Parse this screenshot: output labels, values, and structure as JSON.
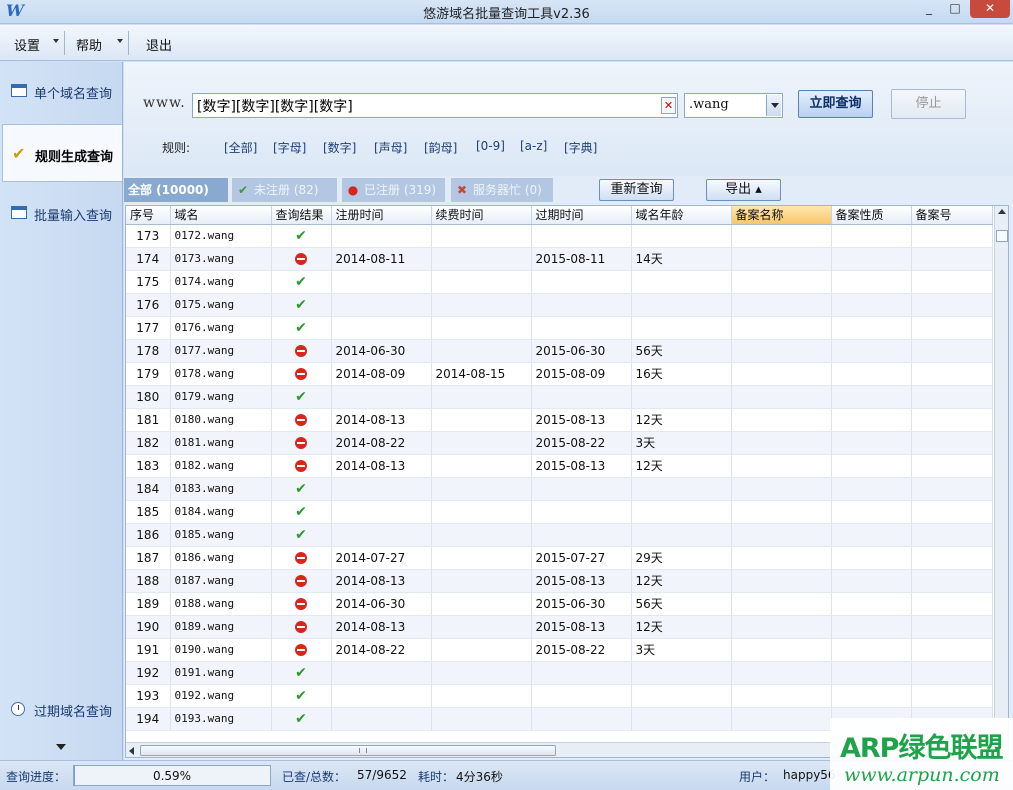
{
  "window": {
    "title": "悠游域名批量查询工具v2.36",
    "minimize": "_",
    "maximize": "□",
    "close": "✕"
  },
  "menu": {
    "settings": "设置",
    "help": "帮助",
    "exit": "退出"
  },
  "sidebar": {
    "items": [
      {
        "label": "单个域名查询",
        "icon": "window-icon"
      },
      {
        "label": "规则生成查询",
        "icon": "check-icon",
        "active": true
      },
      {
        "label": "批量输入查询",
        "icon": "window-icon"
      },
      {
        "label": "过期域名查询",
        "icon": "clock-icon"
      }
    ]
  },
  "query": {
    "prefix": "www.",
    "domain_value": "[数字][数字][数字][数字]",
    "clear_label": "✕",
    "tld_value": ".wang",
    "query_button": "立即查询",
    "stop_button": "停止",
    "rules_label": "规则:",
    "rules": [
      "[全部]",
      "[字母]",
      "[数字]",
      "[声母]",
      "[韵母]",
      "[0-9]",
      "[a-z]",
      "[字典]"
    ]
  },
  "tabs": {
    "all": "全部 (10000)",
    "unregistered": "未注册 (82)",
    "registered": "已注册 (319)",
    "server_busy": "服务器忙 (0)",
    "requery": "重新查询",
    "export": "导出 ▴"
  },
  "colors": {
    "accent": "#8aa9d0",
    "ok": "#2a9a2a",
    "taken": "#d9261c",
    "highlight_header": "#f7c66a",
    "watermark": "#1fa34a"
  },
  "table": {
    "columns": [
      "序号",
      "域名",
      "查询结果",
      "注册时间",
      "续费时间",
      "过期时间",
      "域名年龄",
      "备案名称",
      "备案性质",
      "备案号"
    ],
    "rows": [
      [
        "173",
        "0172.wang",
        "ok",
        "",
        "",
        "",
        ""
      ],
      [
        "174",
        "0173.wang",
        "taken",
        "2014-08-11",
        "",
        "2015-08-11",
        "14天"
      ],
      [
        "175",
        "0174.wang",
        "ok",
        "",
        "",
        "",
        ""
      ],
      [
        "176",
        "0175.wang",
        "ok",
        "",
        "",
        "",
        ""
      ],
      [
        "177",
        "0176.wang",
        "ok",
        "",
        "",
        "",
        ""
      ],
      [
        "178",
        "0177.wang",
        "taken",
        "2014-06-30",
        "",
        "2015-06-30",
        "56天"
      ],
      [
        "179",
        "0178.wang",
        "taken",
        "2014-08-09",
        "2014-08-15",
        "2015-08-09",
        "16天"
      ],
      [
        "180",
        "0179.wang",
        "ok",
        "",
        "",
        "",
        ""
      ],
      [
        "181",
        "0180.wang",
        "taken",
        "2014-08-13",
        "",
        "2015-08-13",
        "12天"
      ],
      [
        "182",
        "0181.wang",
        "taken",
        "2014-08-22",
        "",
        "2015-08-22",
        "3天"
      ],
      [
        "183",
        "0182.wang",
        "taken",
        "2014-08-13",
        "",
        "2015-08-13",
        "12天"
      ],
      [
        "184",
        "0183.wang",
        "ok",
        "",
        "",
        "",
        ""
      ],
      [
        "185",
        "0184.wang",
        "ok",
        "",
        "",
        "",
        ""
      ],
      [
        "186",
        "0185.wang",
        "ok",
        "",
        "",
        "",
        ""
      ],
      [
        "187",
        "0186.wang",
        "taken",
        "2014-07-27",
        "",
        "2015-07-27",
        "29天"
      ],
      [
        "188",
        "0187.wang",
        "taken",
        "2014-08-13",
        "",
        "2015-08-13",
        "12天"
      ],
      [
        "189",
        "0188.wang",
        "taken",
        "2014-06-30",
        "",
        "2015-06-30",
        "56天"
      ],
      [
        "190",
        "0189.wang",
        "taken",
        "2014-08-13",
        "",
        "2015-08-13",
        "12天"
      ],
      [
        "191",
        "0190.wang",
        "taken",
        "2014-08-22",
        "",
        "2015-08-22",
        "3天"
      ],
      [
        "192",
        "0191.wang",
        "ok",
        "",
        "",
        "",
        ""
      ],
      [
        "193",
        "0192.wang",
        "ok",
        "",
        "",
        "",
        ""
      ],
      [
        "194",
        "0193.wang",
        "ok",
        "",
        "",
        "",
        ""
      ]
    ]
  },
  "status": {
    "progress_label": "查询进度：",
    "progress_percent": 0.59,
    "progress_text": "0.59%",
    "checked_label": "已查/总数：",
    "checked_value": "57/9652",
    "time_label": "耗时：",
    "time_value": "4分36秒",
    "user_label": "用户：",
    "user_value": "happy56"
  },
  "watermark": {
    "brand": "ARP绿色联盟",
    "url": "www.arpun.com"
  }
}
